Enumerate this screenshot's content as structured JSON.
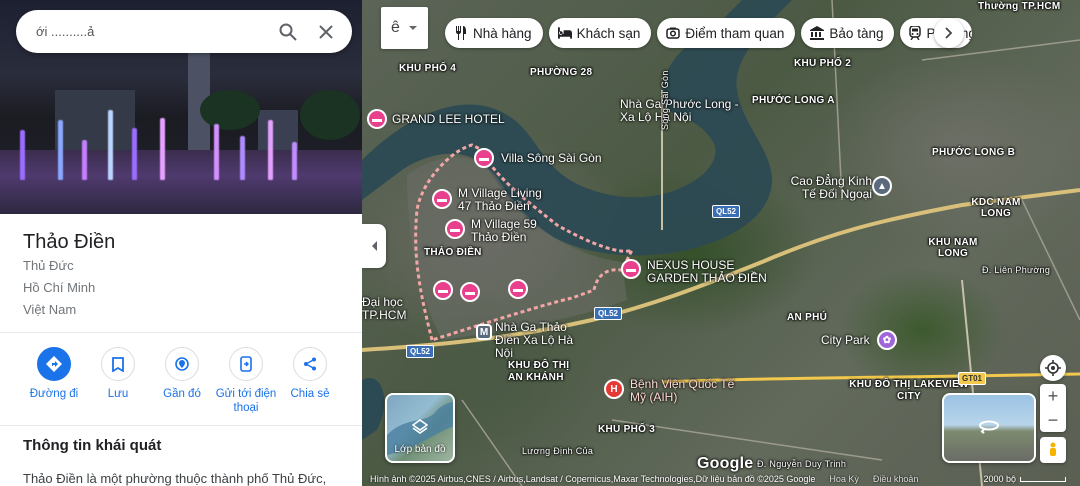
{
  "search": {
    "query": "ới ..........ả"
  },
  "place": {
    "title": "Thảo Điền",
    "district": "Thủ Đức",
    "city": "Hồ Chí Minh",
    "country": "Việt Nam"
  },
  "actions": [
    {
      "label": "Đường đi",
      "icon": "directions-icon"
    },
    {
      "label": "Lưu",
      "icon": "bookmark-icon"
    },
    {
      "label": "Gần đó",
      "icon": "nearby-icon"
    },
    {
      "label": "Gửi tới điện thoại",
      "icon": "send-to-phone-icon"
    },
    {
      "label": "Chia sẻ",
      "icon": "share-icon"
    }
  ],
  "overview": {
    "title": "Thông tin khái quát",
    "text": "Thảo Điền là một phường thuộc thành phố Thủ Đức,"
  },
  "map": {
    "input_tools_glyph": "ê",
    "chips": [
      {
        "label": "Nhà hàng",
        "icon": "restaurant-icon"
      },
      {
        "label": "Khách sạn",
        "icon": "hotel-icon"
      },
      {
        "label": "Điểm tham quan",
        "icon": "camera-icon"
      },
      {
        "label": "Bảo tàng",
        "icon": "museum-icon"
      },
      {
        "label": "Phương tiện",
        "icon": "transit-icon"
      }
    ],
    "area_labels": [
      "KHU PHỐ 4",
      "PHƯỜNG 28",
      "THẢO ĐIỀN",
      "AN PHÚ",
      "KHU ĐÔ THỊ AN KHÁNH",
      "KHU PHỐ 3",
      "PHƯỚC LONG A",
      "PHƯỚC LONG B",
      "KDC NAM LONG",
      "KHU NAM LONG",
      "KHU ĐÔ THỊ LAKEVIEW CITY",
      "KHU PHỐ 2",
      "Thường TP.HCM"
    ],
    "pois": [
      "GRAND LEE HOTEL",
      "Villa Sông Sài Gòn",
      "M Village Living 47 Thảo Điền",
      "M Village 59 Thảo Điền",
      "NEXUS HOUSE GARDEN THẢO ĐIỀN",
      "Nhà Ga Thảo Điền Xa Lộ Hà Nội",
      "Nhà Ga Phước Long - Xa Lộ Hà Nội",
      "Cao Đẳng Kinh Tế Đối Ngoại",
      "City Park",
      "Bệnh Viện Quốc Tế Mỹ (AIH)",
      "Đại học TP.HCM"
    ],
    "roads": [
      "QL52",
      "QL52",
      "QL52",
      "GT01",
      "Sông Sài Gòn",
      "Đ. Liên Phường",
      "Đ. Nguyễn Duy Trinh",
      "Lương Định Của"
    ],
    "layers_label": "Lớp bản đồ",
    "attribution": "Hình ảnh ©2025 Airbus,CNES / Airbus,Landsat / Copernicus,Maxar Technologies,Dữ liệu bản đồ ©2025 Google",
    "region": "Hoa Kỳ",
    "terms": "Điều khoản",
    "scale": "2000 bộ",
    "google_logo": "Google"
  }
}
